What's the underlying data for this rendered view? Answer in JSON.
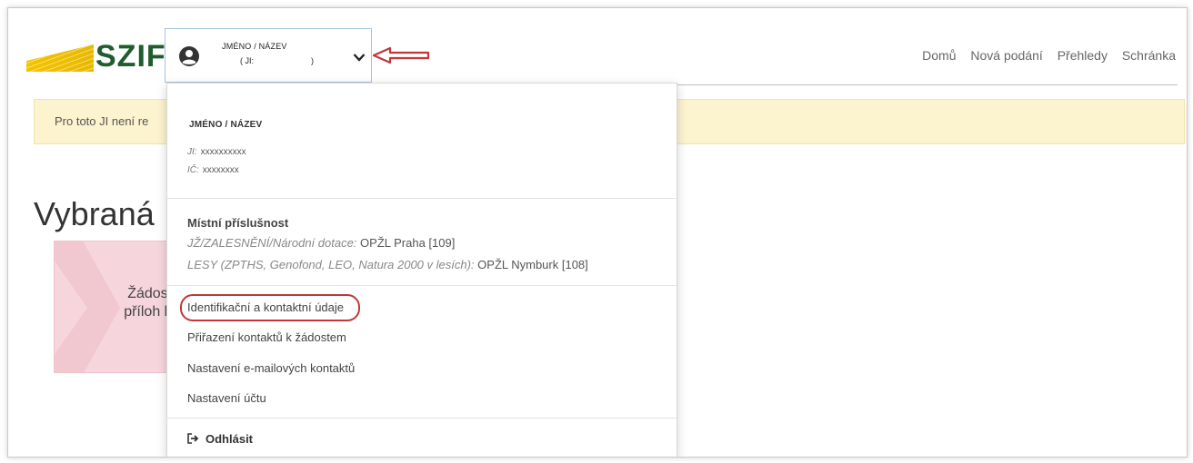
{
  "header": {
    "logo_text": "SZIF",
    "user_button": {
      "name": "JMÉNO / NÁZEV",
      "ji_open": "( JI:",
      "ji_close": ")"
    },
    "nav": [
      "Domů",
      "Nová podání",
      "Přehledy",
      "Schránka"
    ]
  },
  "alert": {
    "text": "Pro toto JI není re"
  },
  "page_title": "Vybraná",
  "tile": {
    "line1": "Žádosti P",
    "line2": "příloh k Žá"
  },
  "dropdown": {
    "name": "JMÉNO / NÁZEV",
    "ji_label": "JI:",
    "ji_value": "xxxxxxxxxx",
    "ic_label": "IČ:",
    "ic_value": "xxxxxxxx",
    "jurisdiction_heading": "Místní příslušnost",
    "rules": [
      {
        "label": "JŽ/ZALESNĚNÍ/Národní dotace:",
        "value": "OPŽL Praha [109]"
      },
      {
        "label": "LESY (ZPTHS, Genofond, LEO, Natura 2000 v lesích):",
        "value": "OPŽL Nymburk [108]"
      }
    ],
    "links": [
      "Identifikační a kontaktní údaje",
      "Přiřazení kontaktů k žádostem",
      "Nastavení e-mailových kontaktů",
      "Nastavení účtu"
    ],
    "logout": "Odhlásit"
  },
  "colors": {
    "logo_green": "#1f5c2e",
    "logo_yellow": "#f4c400",
    "alert_bg": "#fcf3cf",
    "annotation_red": "#c2373a"
  }
}
